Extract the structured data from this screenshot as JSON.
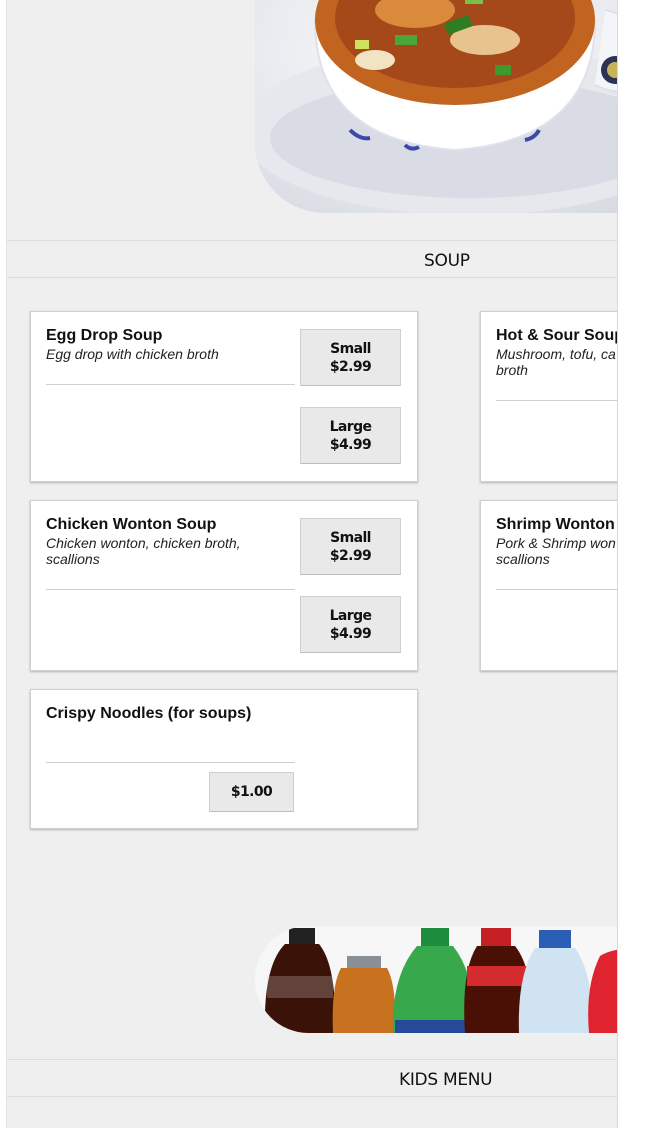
{
  "sections": {
    "soup": "SOUP",
    "kids": "KIDS MENU"
  },
  "images": {
    "hero": "hot-and-sour-soup-photo",
    "drinks": "bottled-drinks-photo"
  },
  "items": [
    {
      "name": "Egg Drop Soup",
      "desc": "Egg drop with chicken broth",
      "prices": [
        {
          "size": "Small",
          "price": "$2.99"
        },
        {
          "size": "Large",
          "price": "$4.99"
        }
      ]
    },
    {
      "name": "Hot & Sour Soup",
      "desc": "Mushroom, tofu, ca",
      "desc2": "broth"
    },
    {
      "name": "Chicken Wonton Soup",
      "desc": "Chicken wonton, chicken broth,",
      "desc2": "scallions",
      "prices": [
        {
          "size": "Small",
          "price": "$2.99"
        },
        {
          "size": "Large",
          "price": "$4.99"
        }
      ]
    },
    {
      "name": "Shrimp Wonton",
      "desc": "Pork & Shrimp won",
      "desc2": "scallions"
    },
    {
      "name": "Crispy Noodles (for soups)",
      "prices": [
        {
          "price": "$1.00"
        }
      ]
    }
  ]
}
